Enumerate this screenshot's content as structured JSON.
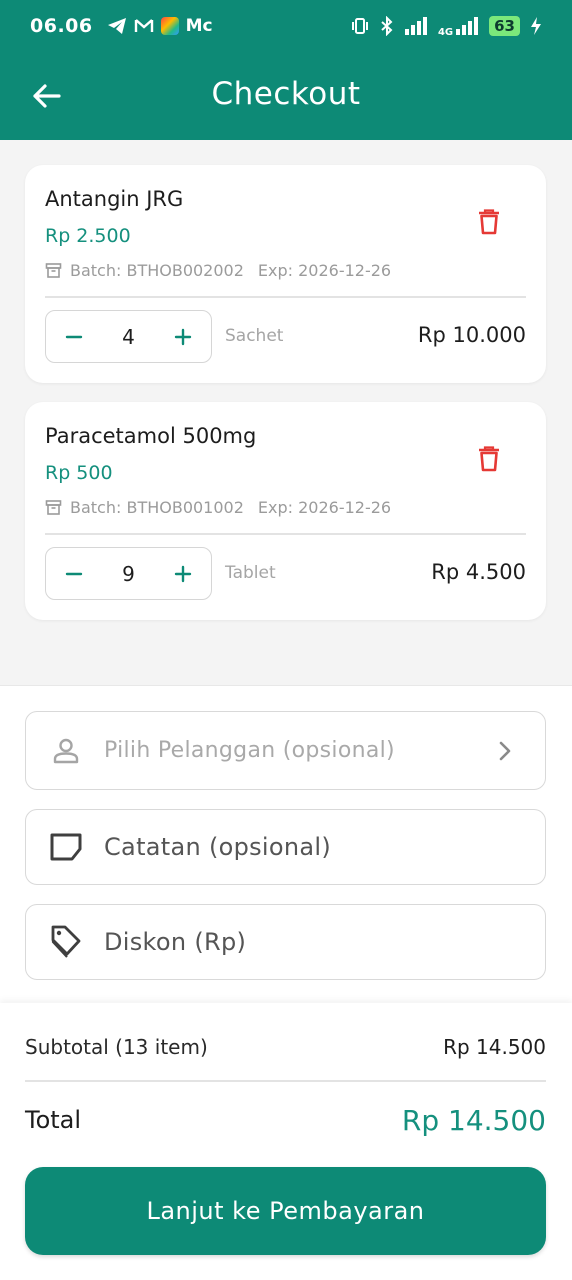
{
  "status_bar": {
    "time": "06.06",
    "app_badge": "Mc",
    "network": "4G",
    "battery": "63"
  },
  "app_bar": {
    "title": "Checkout",
    "back_icon": "arrow-left-icon"
  },
  "cart_items": [
    {
      "name": "Antangin JRG",
      "price": "Rp 2.500",
      "batch": "Batch: BTHOB002002",
      "exp": "Exp: 2026-12-26",
      "quantity": "4",
      "unit": "Sachet",
      "line_total": "Rp 10.000"
    },
    {
      "name": "Paracetamol 500mg",
      "price": "Rp 500",
      "batch": "Batch: BTHOB001002",
      "exp": "Exp: 2026-12-26",
      "quantity": "9",
      "unit": "Tablet",
      "line_total": "Rp 4.500"
    }
  ],
  "form": {
    "customer_placeholder": "Pilih Pelanggan (opsional)",
    "notes_placeholder": "Catatan (opsional)",
    "discount_placeholder": "Diskon (Rp)"
  },
  "summary": {
    "subtotal_label": "Subtotal (13 item)",
    "subtotal_value": "Rp 14.500",
    "total_label": "Total",
    "total_value": "Rp 14.500",
    "pay_button_label": "Lanjut ke Pembayaran"
  },
  "colors": {
    "primary": "#0d8a76",
    "price_text": "#15907e",
    "delete": "#e53935"
  }
}
